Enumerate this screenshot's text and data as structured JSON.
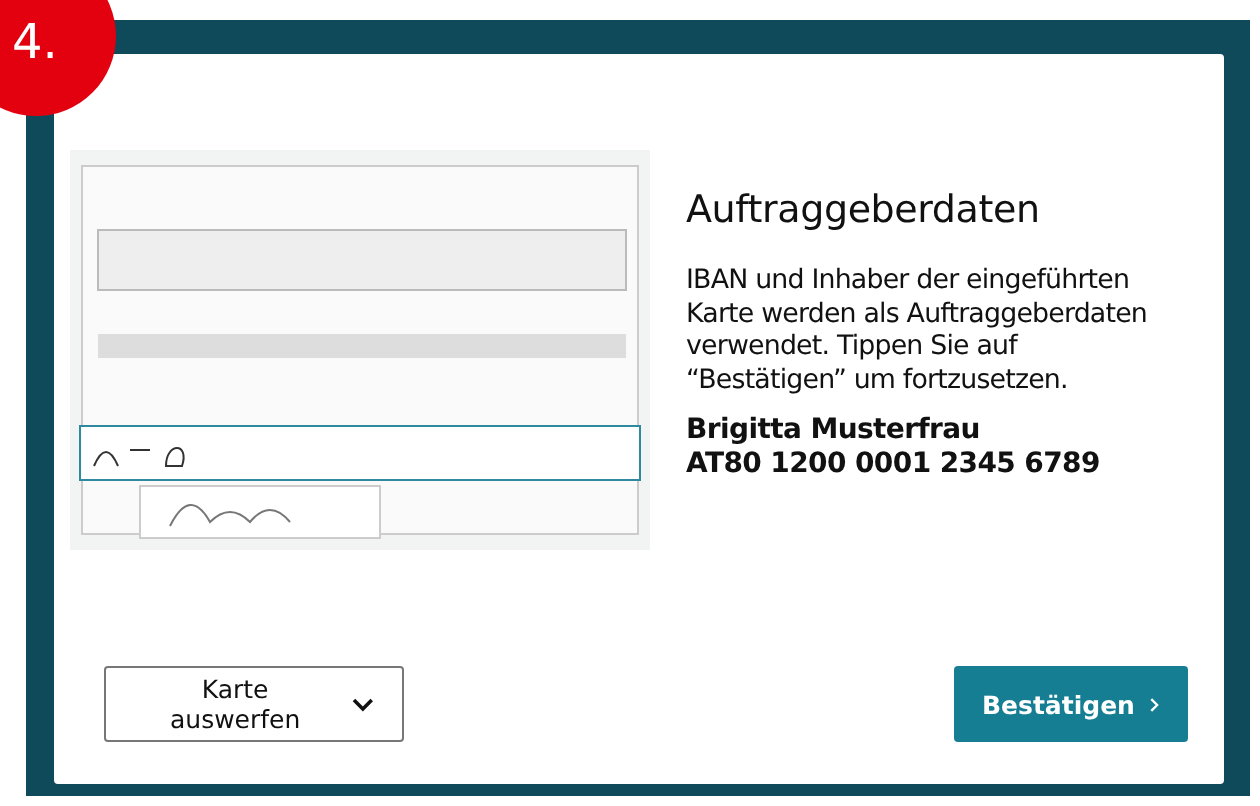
{
  "step_badge": "4.",
  "title": "Auftraggeberdaten",
  "description": "IBAN und Inhaber der eingeführten Karte werden als Auftraggeberdaten verwendet. Tippen Sie auf “Bestätigen” um fortzusetzen.",
  "account_holder": "Brigitta Musterfrau",
  "iban": "AT80 1200 0001 2345 6789",
  "buttons": [
    {
      "label": "Karte auswerfen",
      "kind": "secondary"
    },
    {
      "label": "Bestätigen",
      "kind": "primary"
    }
  ]
}
